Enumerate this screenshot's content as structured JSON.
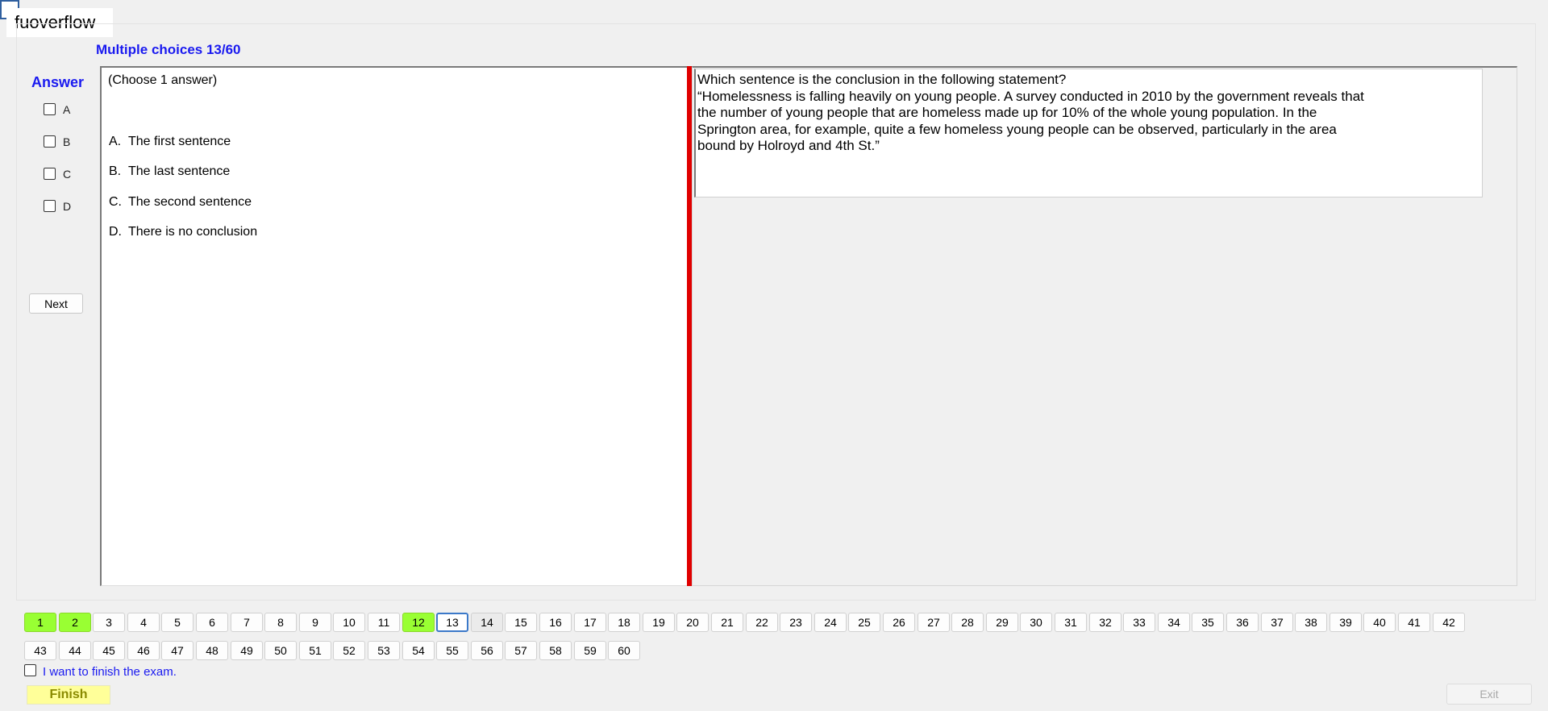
{
  "app": {
    "tag": "fuoverflow"
  },
  "section": {
    "title": "Multiple choices 13/60"
  },
  "answer_panel": {
    "label": "Answer",
    "options": [
      "A",
      "B",
      "C",
      "D"
    ],
    "next_label": "Next"
  },
  "question": {
    "hint": "(Choose 1 answer)",
    "choices": [
      {
        "letter": "A.",
        "text": "The first sentence"
      },
      {
        "letter": "B.",
        "text": "The last sentence"
      },
      {
        "letter": "C.",
        "text": "The second sentence"
      },
      {
        "letter": "D.",
        "text": "There is no conclusion"
      }
    ],
    "prompt_lines": [
      "Which sentence is the conclusion in the following statement?",
      "“Homelessness is falling heavily on young people. A survey conducted in 2010 by the government reveals that",
      "the number of young people that are homeless made up for 10% of the whole young population. In the",
      "Springton area, for example, quite a few homeless young people can be observed, particularly in the area",
      "bound by Holroyd and 4th St.”"
    ]
  },
  "navigation": {
    "row1": [
      "1",
      "2",
      "3",
      "4",
      "5",
      "6",
      "7",
      "8",
      "9",
      "10",
      "11",
      "12",
      "13",
      "14",
      "15",
      "16",
      "17",
      "18",
      "19",
      "20",
      "21",
      "22",
      "23",
      "24",
      "25",
      "26",
      "27",
      "28",
      "29",
      "30",
      "31",
      "32",
      "33",
      "34",
      "35",
      "36",
      "37",
      "38",
      "39",
      "40",
      "41",
      "42"
    ],
    "row2": [
      "43",
      "44",
      "45",
      "46",
      "47",
      "48",
      "49",
      "50",
      "51",
      "52",
      "53",
      "54",
      "55",
      "56",
      "57",
      "58",
      "59",
      "60"
    ],
    "answered": [
      "1",
      "2",
      "12"
    ],
    "current": "13",
    "visited": [
      "14"
    ]
  },
  "footer": {
    "finish_check_label": "I want to finish the exam.",
    "finish_label": "Finish",
    "exit_label": "Exit"
  },
  "colors": {
    "accent_blue": "#1a1af0",
    "answered_green": "#99ff33",
    "splitter_red": "#e00000",
    "finish_yellow": "#ffff99"
  }
}
